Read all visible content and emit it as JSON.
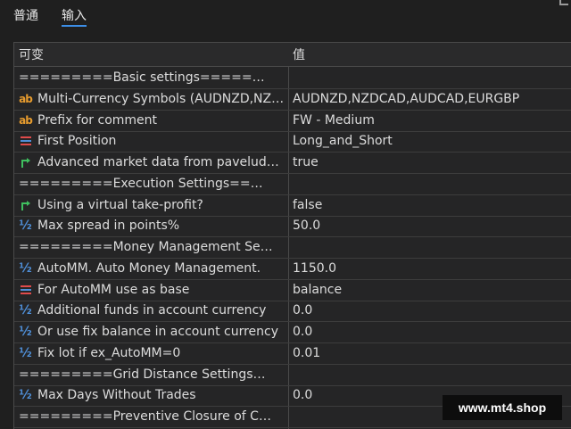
{
  "tabs": [
    {
      "label": "普通"
    },
    {
      "label": "输入"
    }
  ],
  "header": {
    "name": "可变",
    "value": "值"
  },
  "rows": [
    {
      "icon": "",
      "name": "=========Basic settings=========",
      "value": ""
    },
    {
      "icon": "ab-icon",
      "name": "Multi-Currency Symbols (AUDNZD,NZDC...",
      "value": "AUDNZD,NZDCAD,AUDCAD,EURGBP"
    },
    {
      "icon": "ab-icon",
      "name": "Prefix for comment",
      "value": "FW - Medium"
    },
    {
      "icon": "list-icon",
      "name": "First Position",
      "value": "Long_and_Short"
    },
    {
      "icon": "arrow-icon",
      "name": "Advanced market data from paveludose...",
      "value": "true"
    },
    {
      "icon": "",
      "name": "=========Execution Settings=======...",
      "value": ""
    },
    {
      "icon": "arrow-icon",
      "name": "Using a virtual take-profit?",
      "value": "false"
    },
    {
      "icon": "half-icon",
      "name": "Max spread in points%",
      "value": "50.0"
    },
    {
      "icon": "",
      "name": "=========Money Management Settings...",
      "value": ""
    },
    {
      "icon": "half-icon",
      "name": "AutoMM. Auto Money Management.",
      "value": "1150.0"
    },
    {
      "icon": "list-icon",
      "name": "For AutoMM use as base",
      "value": "balance"
    },
    {
      "icon": "half-icon",
      "name": "Additional funds in account currency",
      "value": "0.0"
    },
    {
      "icon": "half-icon",
      "name": "Or use fix balance in account currency",
      "value": "0.0"
    },
    {
      "icon": "half-icon",
      "name": "Fix lot if ex_AutoMM=0",
      "value": "0.01"
    },
    {
      "icon": "",
      "name": "=========Grid Distance Settings=====...",
      "value": ""
    },
    {
      "icon": "half-icon",
      "name": "Max Days Without Trades",
      "value": "0.0"
    },
    {
      "icon": "",
      "name": "=========Preventive Closure of Chains=...",
      "value": ""
    }
  ],
  "watermark": "www.mt4.shop"
}
